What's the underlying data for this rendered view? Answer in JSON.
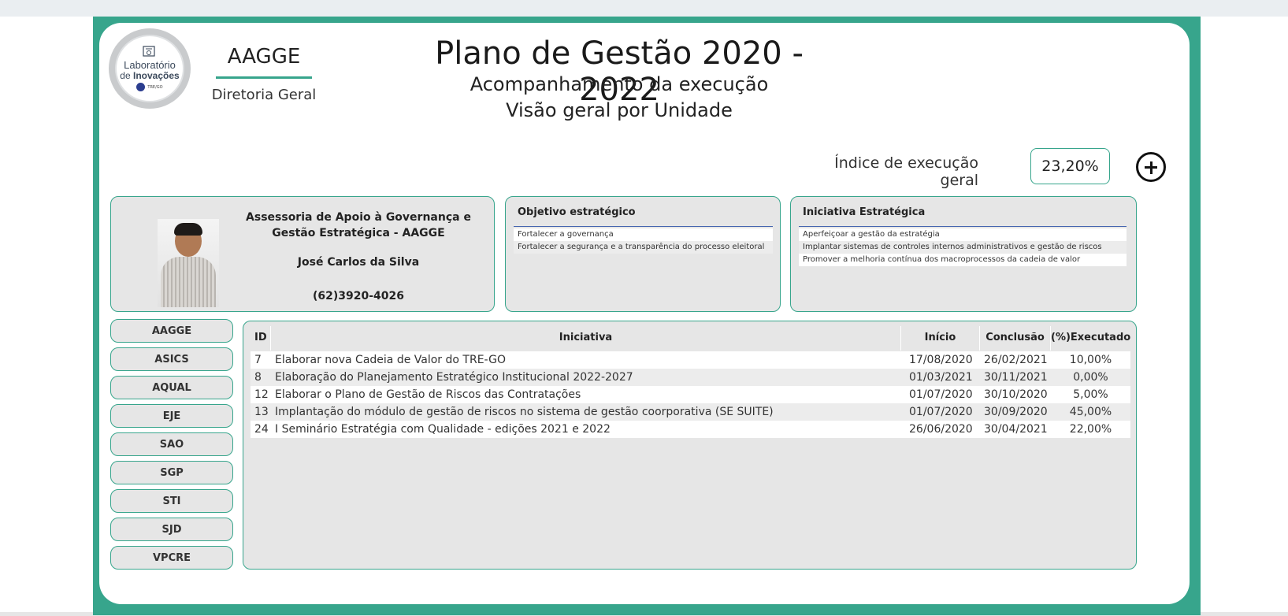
{
  "logo": {
    "line1": "Laboratório",
    "line2_pre": "de ",
    "line2_bold": "Inovações",
    "org": "TRE/GO"
  },
  "unit": {
    "code": "AAGGE",
    "subtitle": "Diretoria Geral"
  },
  "header": {
    "title": "Plano de Gestão 2020 - 2022",
    "subtitle1": "Acompanhamento da execução",
    "subtitle2": "Visão geral por Unidade"
  },
  "indice": {
    "label": "Índice de execução geral",
    "value": "23,20%"
  },
  "person": {
    "unit_line1": "Assessoria de Apoio à Governança e",
    "unit_line2": "Gestão Estratégica - AAGGE",
    "name": "José Carlos da Silva",
    "phone": "(62)3920-4026"
  },
  "objetivo": {
    "title": "Objetivo estratégico",
    "items": [
      "Fortalecer a governança",
      "Fortalecer a segurança e a transparência do processo eleitoral"
    ]
  },
  "iniciativa_estrategica": {
    "title": "Iniciativa Estratégica",
    "items": [
      "Aperfeiçoar a gestão da estratégia",
      "Implantar sistemas de controles internos administrativos e gestão de riscos",
      "Promover a melhoria contínua dos macroprocessos da cadeia de valor"
    ]
  },
  "nav": [
    "AAGGE",
    "ASICS",
    "AQUAL",
    "EJE",
    "SAO",
    "SGP",
    "STI",
    "SJD",
    "VPCRE"
  ],
  "table": {
    "headers": {
      "id": "ID",
      "iniciativa": "Iniciativa",
      "inicio": "Início",
      "conclusao": "Conclusão",
      "executado": "(%)Executado"
    },
    "rows": [
      {
        "id": "7",
        "iniciativa": "Elaborar nova Cadeia de Valor do TRE-GO",
        "inicio": "17/08/2020",
        "conclusao": "26/02/2021",
        "executado": "10,00%"
      },
      {
        "id": "8",
        "iniciativa": "Elaboração do Planejamento Estratégico Institucional 2022-2027",
        "inicio": "01/03/2021",
        "conclusao": "30/11/2021",
        "executado": "0,00%"
      },
      {
        "id": "12",
        "iniciativa": "Elaborar o Plano de Gestão de Riscos das Contratações",
        "inicio": "01/07/2020",
        "conclusao": "30/10/2020",
        "executado": "5,00%"
      },
      {
        "id": "13",
        "iniciativa": "Implantação do módulo de gestão de riscos no sistema de gestão coorporativa (SE SUITE)",
        "inicio": "01/07/2020",
        "conclusao": "30/09/2020",
        "executado": "45,00%"
      },
      {
        "id": "24",
        "iniciativa": "I Seminário Estratégia com Qualidade - edições 2021 e 2022",
        "inicio": "26/06/2020",
        "conclusao": "30/04/2021",
        "executado": "22,00%"
      }
    ]
  },
  "colors": {
    "accent": "#37a58c",
    "card_bg": "#e6e6e6",
    "rule": "#4566b0"
  }
}
